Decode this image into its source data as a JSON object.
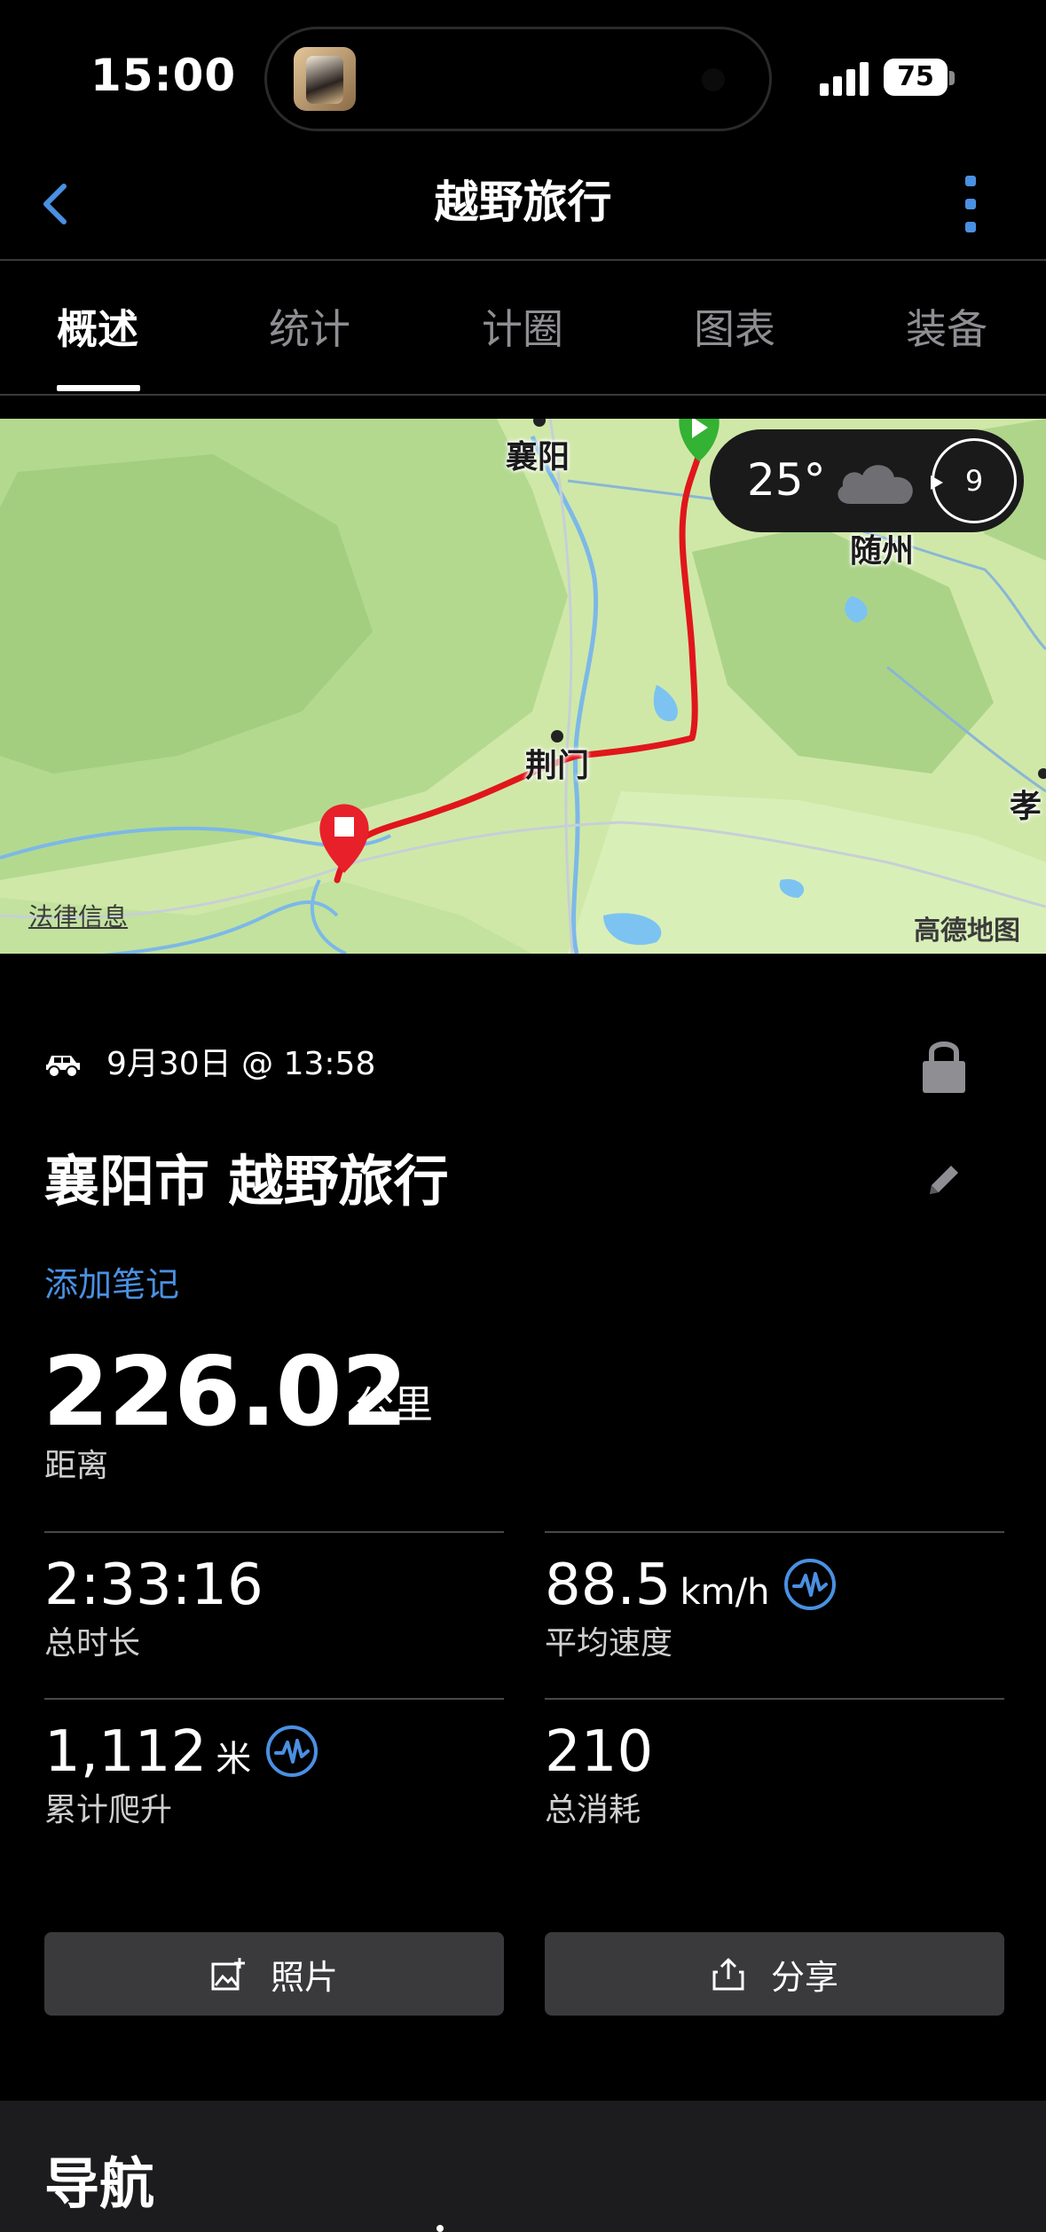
{
  "status_bar": {
    "time": "15:00",
    "battery": "75"
  },
  "header": {
    "title": "越野旅行",
    "back_icon": "chevron-left-icon",
    "more_icon": "more-vertical-icon"
  },
  "tabs": [
    {
      "label": "概述",
      "active": true
    },
    {
      "label": "统计",
      "active": false
    },
    {
      "label": "计圈",
      "active": false
    },
    {
      "label": "图表",
      "active": false
    },
    {
      "label": "装备",
      "active": false
    }
  ],
  "map": {
    "labels": {
      "xiangyang": "襄阳",
      "suizhou": "随州",
      "jingmen": "荆门",
      "xiao": "孝"
    },
    "legal_link": "法律信息",
    "provider": "高德地图",
    "weather": {
      "temperature": "25°",
      "condition_icon": "cloud-icon",
      "wind": "9"
    },
    "colors": {
      "route": "#e0161b",
      "start_marker": "#34b233",
      "end_marker": "#e8202a"
    }
  },
  "activity": {
    "type_icon": "offroad-car-icon",
    "date": "9月30日 @ 13:58",
    "title": "襄阳市 越野旅行",
    "add_note": "添加笔记",
    "distance": {
      "value": "226.02",
      "unit": "公里",
      "label": "距离"
    },
    "stats": [
      {
        "key": "total_time",
        "value": "2:33:16",
        "unit": "",
        "label": "总时长",
        "has_icon": false
      },
      {
        "key": "avg_speed",
        "value": "88.5",
        "unit": "km/h",
        "label": "平均速度",
        "has_icon": true
      },
      {
        "key": "total_ascent",
        "value": "1,112",
        "unit": "米",
        "label": "累计爬升",
        "has_icon": true
      },
      {
        "key": "calories",
        "value": "210",
        "unit": "",
        "label": "总消耗",
        "has_icon": false
      }
    ]
  },
  "actions": {
    "photos": "照片",
    "share": "分享"
  },
  "navigation_section": {
    "title": "导航"
  },
  "accent_color": "#4a90e2"
}
